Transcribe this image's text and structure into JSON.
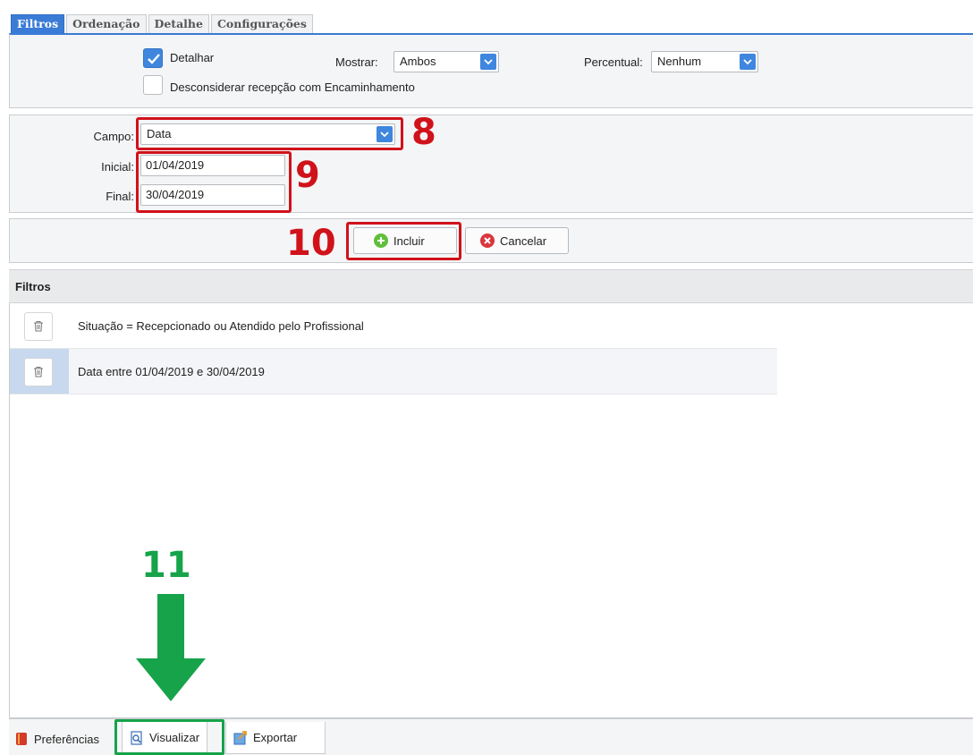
{
  "tabs": [
    "Filtros",
    "Ordenação",
    "Detalhe",
    "Configurações"
  ],
  "options": {
    "detalhar_label": "Detalhar",
    "detalhar_checked": true,
    "desconsiderar_label": "Desconsiderar recepção com Encaminhamento",
    "desconsiderar_checked": false,
    "mostrar_label": "Mostrar:",
    "mostrar_value": "Ambos",
    "percentual_label": "Percentual:",
    "percentual_value": "Nenhum"
  },
  "filter_form": {
    "campo_label": "Campo:",
    "campo_value": "Data",
    "inicial_label": "Inicial:",
    "inicial_value": "01/04/2019",
    "final_label": "Final:",
    "final_value": "30/04/2019"
  },
  "actions": {
    "incluir_label": "Incluir",
    "cancelar_label": "Cancelar"
  },
  "filters_list": {
    "header": "Filtros",
    "items": [
      "Situação = Recepcionado ou Atendido pelo Profissional",
      "Data entre 01/04/2019 e 30/04/2019"
    ]
  },
  "bottom_bar": {
    "preferencias_label": "Preferências",
    "visualizar_label": "Visualizar",
    "exportar_label": "Exportar"
  },
  "annotations": {
    "step8": "8",
    "step9": "9",
    "step10": "10",
    "step11": "11"
  },
  "colors": {
    "accent_blue": "#3a7bd5",
    "annotation_red": "#d0121b",
    "annotation_green": "#16a34a"
  }
}
